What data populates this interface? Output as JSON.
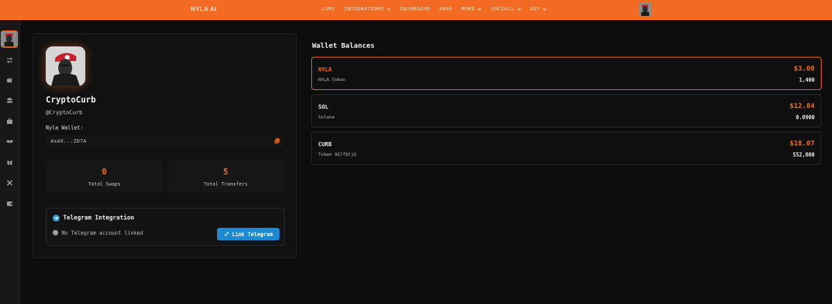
{
  "brand": "NYLA AI",
  "nav": {
    "items": [
      {
        "label": "LORE",
        "dropdown": false
      },
      {
        "label": "INTEGRATIONS",
        "dropdown": true
      },
      {
        "label": "DASHBOARD",
        "dropdown": false
      },
      {
        "label": "SWAP",
        "dropdown": false
      },
      {
        "label": "MORE",
        "dropdown": true
      },
      {
        "label": "SOCIALS",
        "dropdown": true
      },
      {
        "label": "BUY",
        "dropdown": true
      }
    ]
  },
  "sidebar": {
    "icons": [
      "arrows-swap-icon",
      "wallet-cards-icon",
      "users-icon",
      "briefcase-icon",
      "handshake-icon",
      "gift-icon",
      "tools-icon",
      "wallet-icon"
    ]
  },
  "profile": {
    "name": "CryptoCurb",
    "handle": "@CryptoCurb",
    "wallet_label": "Nyla Wallet:",
    "wallet_address": "AsAX...ZD7A",
    "stats": [
      {
        "value": "0",
        "label": "Total Swaps"
      },
      {
        "value": "5",
        "label": "Total Transfers"
      }
    ],
    "telegram": {
      "title": "Telegram Integration",
      "status": "No Telegram account linked",
      "button_label": "Link Telegram"
    }
  },
  "balances": {
    "title": "Wallet Balances",
    "items": [
      {
        "symbol": "NYLA",
        "name": "NYLA Token",
        "usd": "$3.08",
        "amount": "1,400",
        "active": true
      },
      {
        "symbol": "SOL",
        "name": "Solana",
        "usd": "$12.84",
        "amount": "0.0900",
        "active": false
      },
      {
        "symbol": "CURB",
        "name": "Token 9G7fQtjQ",
        "usd": "$18.07",
        "amount": "552,000",
        "active": false
      }
    ]
  },
  "colors": {
    "accent": "#f26a24",
    "background": "#0c0c0c",
    "card": "#111111",
    "telegram_blue": "#1e88d0"
  }
}
